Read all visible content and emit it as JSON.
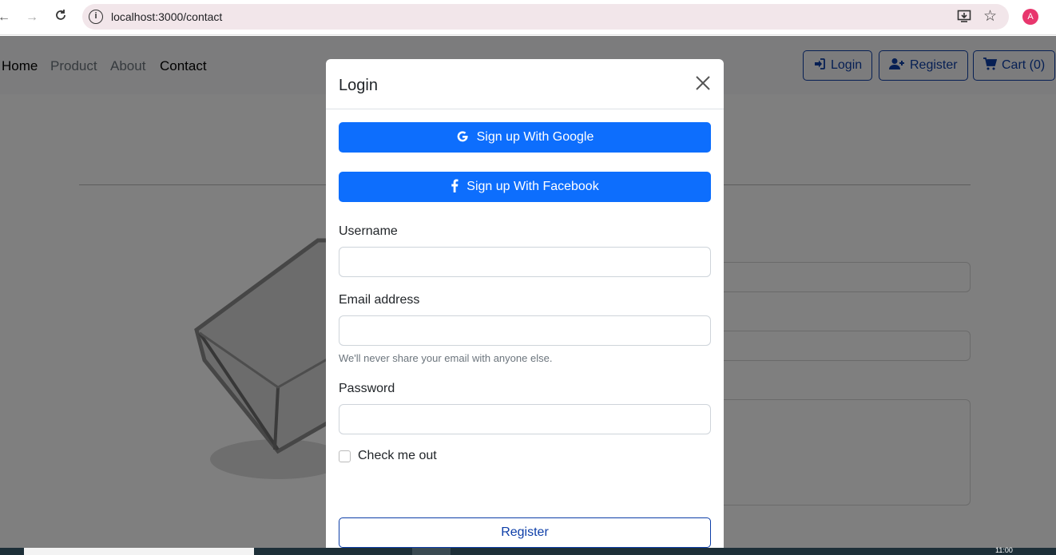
{
  "browser": {
    "url": "localhost:3000/contact",
    "profile_initial": "A",
    "icons": [
      "back-arrow-icon",
      "forward-arrow-icon",
      "reload-icon",
      "site-info-icon",
      "install-app-icon",
      "bookmark-star-icon"
    ]
  },
  "navbar": {
    "links": [
      {
        "label": "Home",
        "active": true
      },
      {
        "label": "Product",
        "active": false
      },
      {
        "label": "About",
        "active": false
      },
      {
        "label": "Contact",
        "active": true
      }
    ],
    "login_label": "Login",
    "register_label": "Register",
    "cart_label": "Cart (0)"
  },
  "modal": {
    "title": "Login",
    "google_label": "Sign up With Google",
    "facebook_label": "Sign up With Facebook",
    "username_label": "Username",
    "email_label": "Email address",
    "email_help": "We'll never share your email with anyone else.",
    "password_label": "Password",
    "checkbox_label": "Check me out",
    "register_label": "Register"
  },
  "colors": {
    "primary": "#0d6efd",
    "outline": "#0d3ea8",
    "backdrop": "rgba(0,0,0,0.5)",
    "profile": "#e8366d"
  },
  "taskbar": {
    "clock": "11:00"
  }
}
